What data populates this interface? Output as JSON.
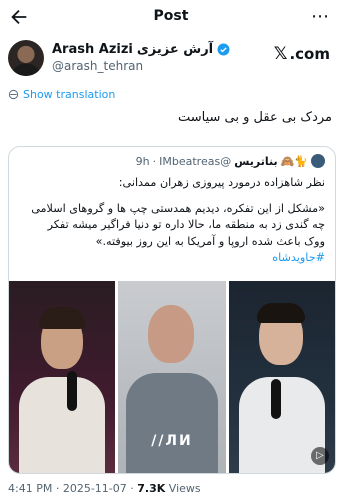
{
  "header": {
    "title": "Post"
  },
  "author": {
    "name": "Arash Azizi",
    "name_fa": "آرش عزیزی",
    "handle": "@arash_tehran",
    "verified_color": "#1d9bf0"
  },
  "brand": {
    "label": ".com"
  },
  "translate_label": "Show translation",
  "tweet_text": "مردک بی عقل و بی سیاست",
  "quote": {
    "name": "بناتریس",
    "handle": "@IMbeatreas",
    "time": "9h",
    "line1": "نظر شاهزاده درمورد پیروزی زهران ممدانی:",
    "line2": "«مشکل از این تفکره، دیدیم همدستی چپ ها و گروهای اسلامی",
    "line3": "چه گندی زد به منطقه ما، حالا داره تو دنیا فراگیر میشه تفکر",
    "line4": "ووک باعث شده اروپا و آمریکا به این روز بیوفته.»",
    "hashtag": "#جاویدشاه",
    "watermark": "//ЛИ"
  },
  "meta": {
    "time": "4:41 PM",
    "date": "2025-11-07",
    "views_count": "7.3K",
    "views_label": "Views"
  }
}
